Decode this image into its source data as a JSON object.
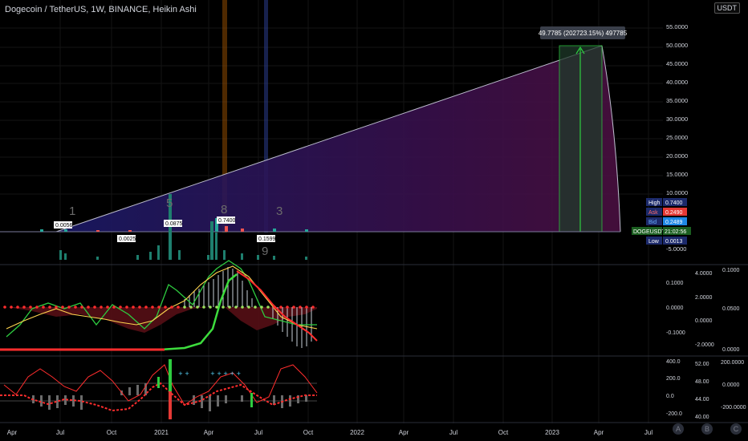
{
  "header": {
    "title": "Dogecoin / TetherUS, 1W, BINANCE, Heikin Ashi"
  },
  "currency": {
    "label": "USDT"
  },
  "measure": {
    "label": "49.7785 (202723.15%) 497785"
  },
  "price_axis": {
    "ticks": [
      "55.0000",
      "50.0000",
      "45.0000",
      "40.0000",
      "35.0000",
      "30.0000",
      "25.0000",
      "20.0000",
      "15.0000",
      "10.0000",
      "-5.0000"
    ]
  },
  "stats": [
    {
      "label": "High",
      "value": "0.7400",
      "color": "#2b3a8c"
    },
    {
      "label": "Ask",
      "value": "0.2490",
      "color": "#e53935"
    },
    {
      "label": "Bid",
      "value": "0.2489",
      "color": "#1e88e5"
    },
    {
      "label": "DOGEUSDT",
      "value": "21:02:56",
      "color": "#1b5e20"
    },
    {
      "label": "Low",
      "value": "0.0013",
      "color": "#2b3a8c"
    }
  ],
  "price_labels": [
    {
      "text": "0.0056"
    },
    {
      "text": "0.0025"
    },
    {
      "text": "0.0875"
    },
    {
      "text": "0.7400"
    },
    {
      "text": "0.1599"
    }
  ],
  "wave_labels": [
    "1",
    "5",
    "8",
    "3",
    "9"
  ],
  "macd_axis": {
    "right1": [
      "0.1000",
      "0.0000",
      "-0.1000"
    ],
    "right2": [
      "4.0000",
      "2.0000",
      "0.0000",
      "-2.0000"
    ],
    "right3": [
      "0.1000",
      "0.0500",
      "0.0000"
    ]
  },
  "rsi_axis": {
    "right1": [
      "400.0",
      "200.0",
      "0.0",
      "-200.0"
    ],
    "right2": [
      "52.00",
      "48.00",
      "44.00",
      "40.00"
    ],
    "right3": [
      "200.0000",
      "0.0000",
      "-200.0000"
    ]
  },
  "time_axis": [
    "Apr",
    "Jul",
    "Oct",
    "2021",
    "Apr",
    "Jul",
    "Oct",
    "2022",
    "Apr",
    "Jul",
    "Oct",
    "2023",
    "Apr",
    "Jul"
  ],
  "badges": [
    "A",
    "B",
    "C"
  ],
  "chart_data": {
    "type": "line",
    "title": "Dogecoin / TetherUS, 1W, BINANCE, Heikin Ashi",
    "projection": {
      "start_price": 0.0056,
      "target_price": 49.7785,
      "change_pct": 202723.15
    },
    "markers": {
      "high": 0.74,
      "ask": 0.249,
      "bid": 0.2489,
      "low": 0.0013
    }
  }
}
